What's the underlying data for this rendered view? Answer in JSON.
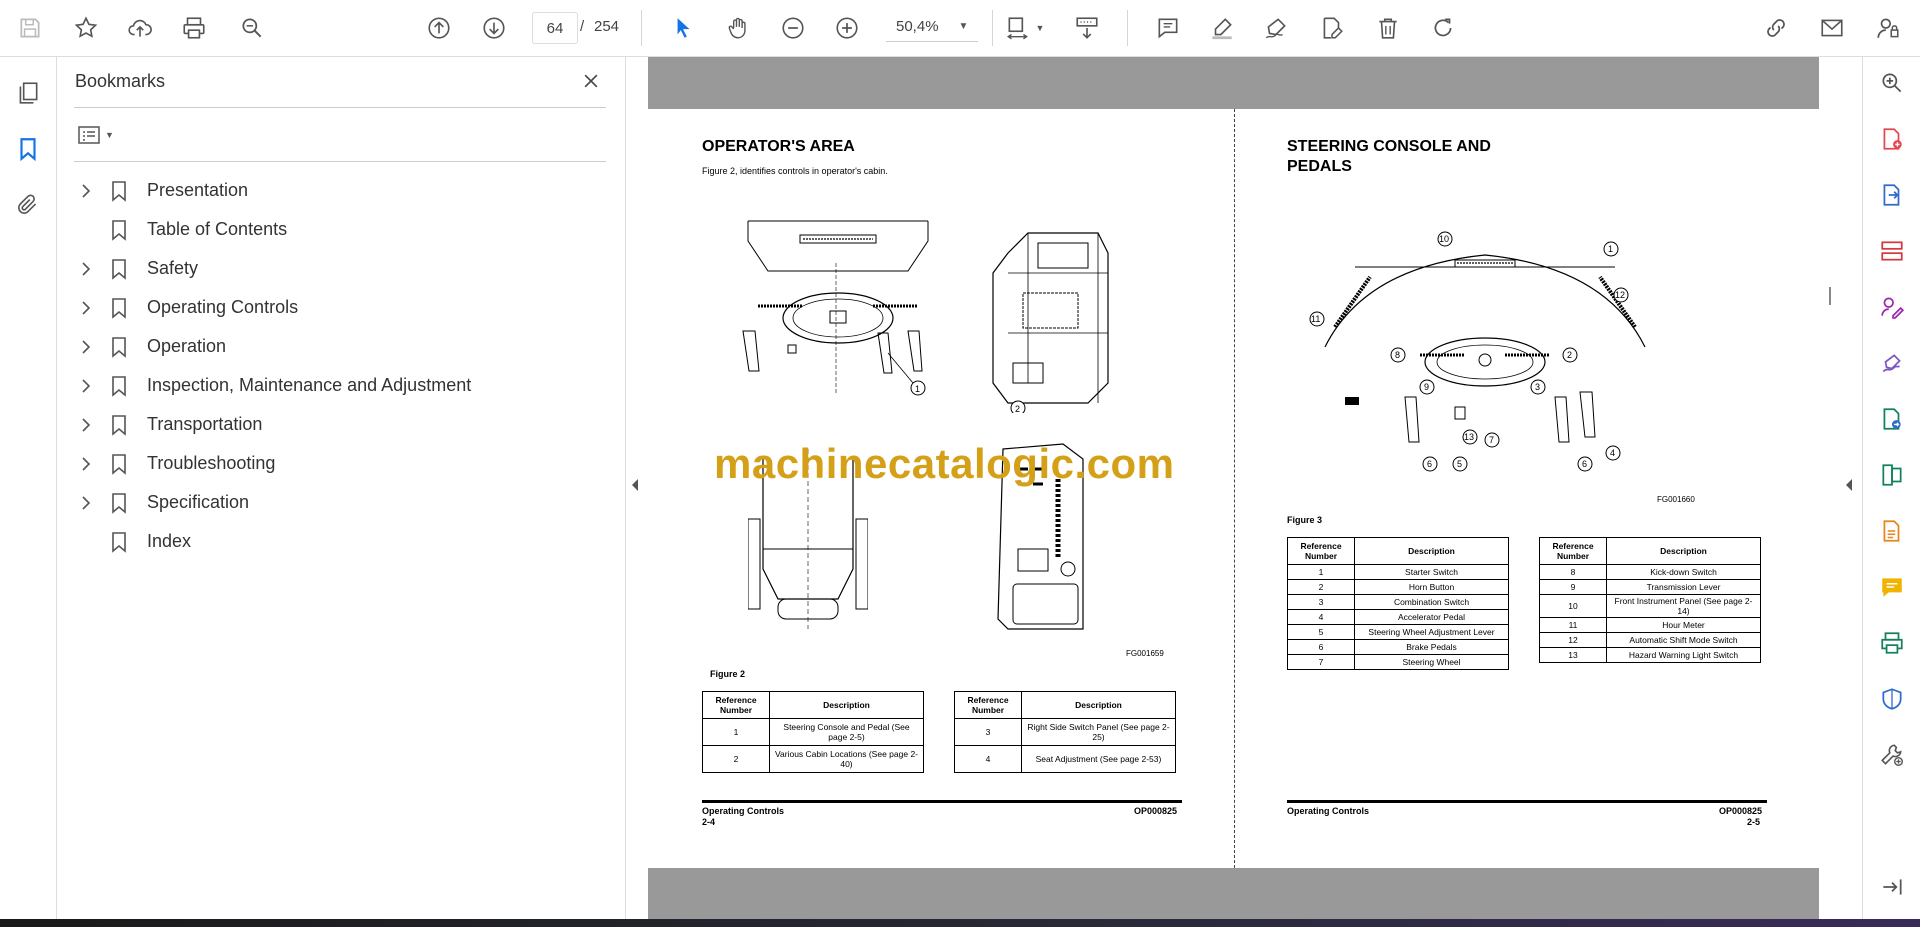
{
  "toolbar": {
    "page_current": "64",
    "page_total": "254",
    "page_separator": "/",
    "zoom": "50,4%"
  },
  "bookmarks": {
    "title": "Bookmarks",
    "items": [
      {
        "label": "Presentation",
        "expandable": true
      },
      {
        "label": "Table of Contents",
        "expandable": false
      },
      {
        "label": "Safety",
        "expandable": true
      },
      {
        "label": "Operating Controls",
        "expandable": true
      },
      {
        "label": "Operation",
        "expandable": true
      },
      {
        "label": "Inspection, Maintenance and Adjustment",
        "expandable": true
      },
      {
        "label": "Transportation",
        "expandable": true
      },
      {
        "label": "Troubleshooting",
        "expandable": true
      },
      {
        "label": "Specification",
        "expandable": true
      },
      {
        "label": "Index",
        "expandable": false
      }
    ]
  },
  "left_page": {
    "title": "OPERATOR'S AREA",
    "intro": "Figure 2, identifies controls in operator's cabin.",
    "figure_code": "FG001659",
    "figure_label": "Figure 2",
    "table_headers": [
      "Reference Number",
      "Description"
    ],
    "table_a": [
      {
        "ref": "1",
        "desc": "Steering Console and Pedal (See page 2-5)"
      },
      {
        "ref": "2",
        "desc": "Various Cabin Locations (See page 2-40)"
      }
    ],
    "table_b": [
      {
        "ref": "3",
        "desc": "Right Side Switch Panel (See page 2-25)"
      },
      {
        "ref": "4",
        "desc": "Seat Adjustment (See page 2-53)"
      }
    ],
    "footer_left": "Operating Controls",
    "footer_page": "2-4",
    "footer_right": "OP000825"
  },
  "right_page": {
    "title_line1": "STEERING CONSOLE AND",
    "title_line2": "PEDALS",
    "figure_code": "FG001660",
    "figure_label": "Figure 3",
    "table_headers": [
      "Reference Number",
      "Description"
    ],
    "table_a": [
      {
        "ref": "1",
        "desc": "Starter Switch"
      },
      {
        "ref": "2",
        "desc": "Horn Button"
      },
      {
        "ref": "3",
        "desc": "Combination Switch"
      },
      {
        "ref": "4",
        "desc": "Accelerator Pedal"
      },
      {
        "ref": "5",
        "desc": "Steering Wheel Adjustment Lever"
      },
      {
        "ref": "6",
        "desc": "Brake Pedals"
      },
      {
        "ref": "7",
        "desc": "Steering Wheel"
      }
    ],
    "table_b": [
      {
        "ref": "8",
        "desc": "Kick-down Switch"
      },
      {
        "ref": "9",
        "desc": "Transmission Lever"
      },
      {
        "ref": "10",
        "desc": "Front Instrument Panel (See page 2-14)"
      },
      {
        "ref": "11",
        "desc": "Hour Meter"
      },
      {
        "ref": "12",
        "desc": "Automatic Shift Mode Switch"
      },
      {
        "ref": "13",
        "desc": "Hazard Warning Light Switch"
      }
    ],
    "footer_left": "Operating Controls",
    "footer_page": "2-5",
    "footer_right": "OP000825"
  },
  "watermark": "machinecatalogic.com",
  "colors": {
    "accent": "#1473e6",
    "watermark": "#d4a017",
    "gray_band": "#999999"
  }
}
